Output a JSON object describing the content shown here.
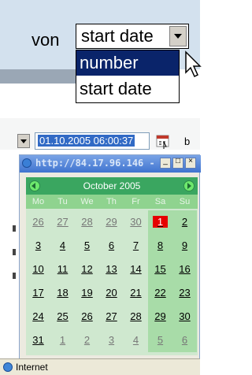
{
  "top": {
    "label": "von",
    "select_value": "start date",
    "dropdown_options": [
      "number",
      "start date"
    ]
  },
  "datepicker": {
    "field_value": "01.10.2005 06:00:37",
    "trailing_text": "b",
    "popup_url": "http://84.17.96.146 -",
    "calendar": {
      "title": "October 2005",
      "weekdays": [
        "Mo",
        "Tu",
        "We",
        "Th",
        "Fr",
        "Sa",
        "Su"
      ],
      "weeks": [
        [
          "26",
          "27",
          "28",
          "29",
          "30",
          "1",
          "2"
        ],
        [
          "3",
          "4",
          "5",
          "6",
          "7",
          "8",
          "9"
        ],
        [
          "10",
          "11",
          "12",
          "13",
          "14",
          "15",
          "16"
        ],
        [
          "17",
          "18",
          "19",
          "20",
          "21",
          "22",
          "23"
        ],
        [
          "24",
          "25",
          "26",
          "27",
          "28",
          "29",
          "30"
        ],
        [
          "31",
          "1",
          "2",
          "3",
          "4",
          "5",
          "6"
        ]
      ]
    },
    "status_text": "Internet"
  },
  "colors": {
    "calendar_header": "#3aa660",
    "selection": "#0a246a",
    "today_marker": "#e60000"
  }
}
